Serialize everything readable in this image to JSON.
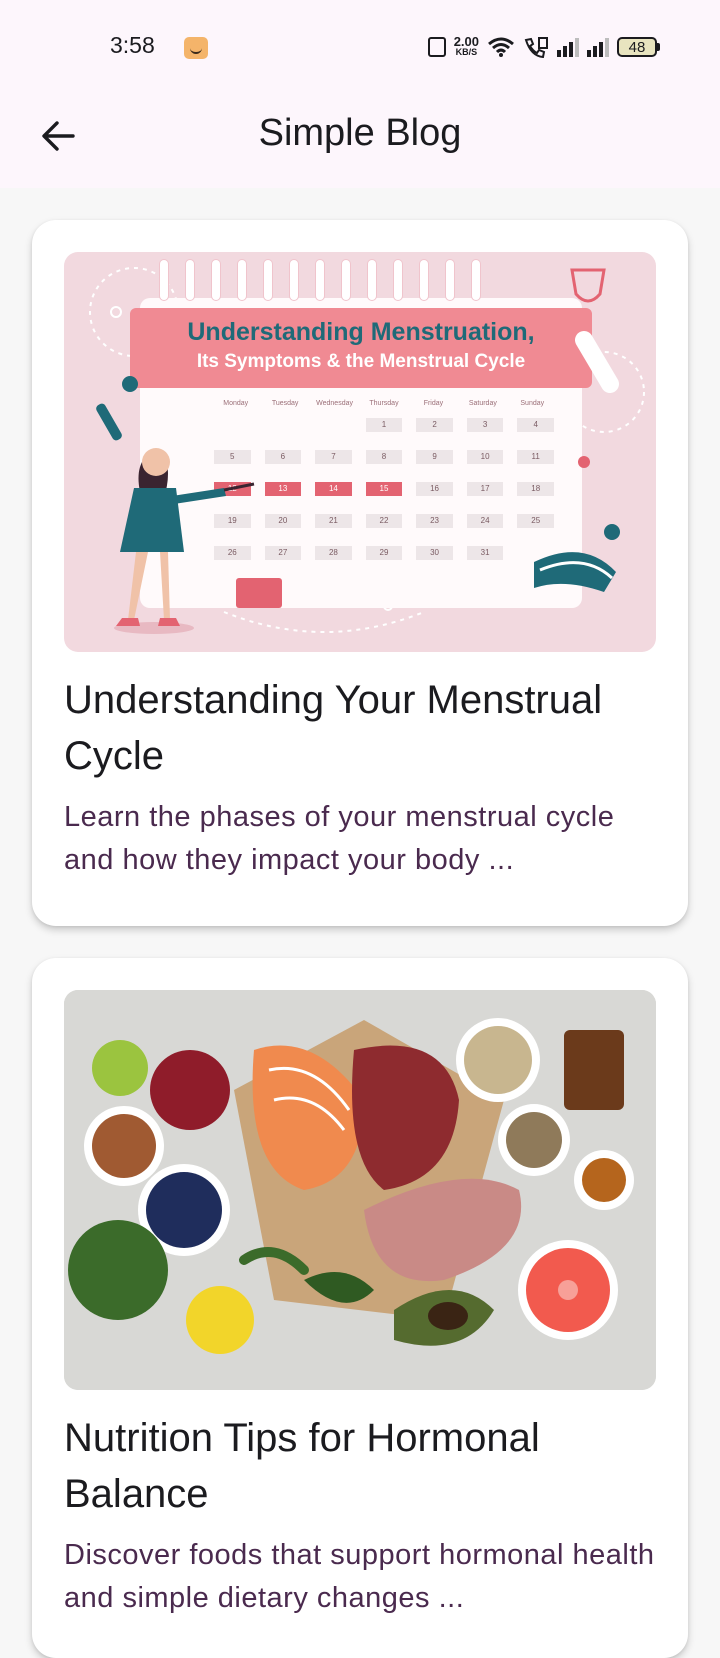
{
  "status": {
    "time": "3:58",
    "net_speed": "2.00",
    "net_unit": "KB/S",
    "battery": "48"
  },
  "appbar": {
    "title": "Simple Blog",
    "back_icon": "arrow-left-icon"
  },
  "posts": [
    {
      "title": "Understanding Your Menstrual Cycle",
      "excerpt": "Learn the phases of your menstrual cycle and how they impact your body ...",
      "image": {
        "heading_line1": "Understanding Menstruation,",
        "heading_line2": "Its Symptoms & the Menstrual Cycle",
        "weekdays": [
          "Monday",
          "Tuesday",
          "Wednesday",
          "Thursday",
          "Friday",
          "Saturday",
          "Sunday"
        ]
      }
    },
    {
      "title": "Nutrition Tips for Hormonal Balance",
      "excerpt": "Discover foods that support hormonal health and simple dietary changes ..."
    }
  ]
}
